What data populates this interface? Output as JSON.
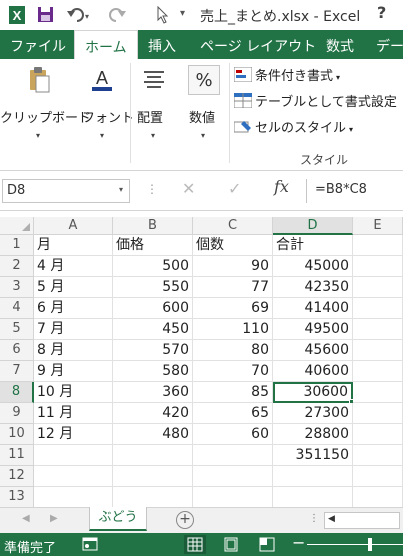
{
  "title_bar": {
    "title": "売上_まとめ.xlsx - Excel",
    "help": "?"
  },
  "ribbon_tabs": [
    "ファイル",
    "ホーム",
    "挿入",
    "ページ レイアウト",
    "数式",
    "デー"
  ],
  "ribbon": {
    "clipboard": "クリップボード",
    "font": "フォント",
    "alignment": "配置",
    "number": "数値",
    "styles": {
      "conditional_formatting": "条件付き書式",
      "format_as_table": "テーブルとして書式設定",
      "cell_styles": "セルのスタイル",
      "group_label": "スタイル"
    },
    "number_icon": "%"
  },
  "formula_bar": {
    "name_box": "D8",
    "formula": "=B8*C8",
    "fx": "fx"
  },
  "grid": {
    "columns": [
      "A",
      "B",
      "C",
      "D",
      "E"
    ],
    "selected_column": "D",
    "rows": [
      "1",
      "2",
      "3",
      "4",
      "5",
      "6",
      "7",
      "8",
      "9",
      "10",
      "11",
      "12",
      "13"
    ],
    "selected_row": "8",
    "cells": [
      [
        "月",
        "価格",
        "個数",
        "合計"
      ],
      [
        "4 月",
        "500",
        "90",
        "45000"
      ],
      [
        "5 月",
        "550",
        "77",
        "42350"
      ],
      [
        "6 月",
        "600",
        "69",
        "41400"
      ],
      [
        "7 月",
        "450",
        "110",
        "49500"
      ],
      [
        "8 月",
        "570",
        "80",
        "45600"
      ],
      [
        "9 月",
        "580",
        "70",
        "40600"
      ],
      [
        "10 月",
        "360",
        "85",
        "30600"
      ],
      [
        "11 月",
        "420",
        "65",
        "27300"
      ],
      [
        "12 月",
        "480",
        "60",
        "28800"
      ],
      [
        "",
        "",
        "",
        "351150"
      ],
      [
        "",
        "",
        "",
        ""
      ],
      [
        "",
        "",
        "",
        ""
      ]
    ]
  },
  "sheet_tabs": {
    "active": "ぶどう",
    "add": "+"
  },
  "status_bar": {
    "status": "準備完了"
  }
}
